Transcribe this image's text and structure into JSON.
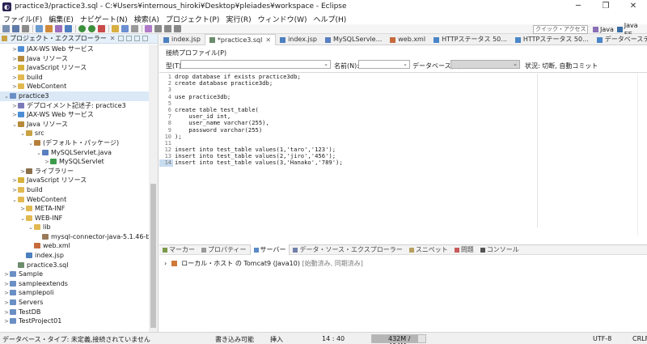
{
  "window": {
    "title": "practice3/practice3.sql - C:¥Users¥internous_hiroki¥Desktop¥pleiades¥workspace - Eclipse",
    "minimize": "─",
    "maximize": "❐",
    "close": "✕"
  },
  "menu": [
    "ファイル(F)",
    "編集(E)",
    "ナビゲート(N)",
    "検索(A)",
    "プロジェクト(P)",
    "実行(R)",
    "ウィンドウ(W)",
    "ヘルプ(H)"
  ],
  "toolbar": {
    "quick_access_placeholder": "クイック・アクセス",
    "perspective_java": "Java",
    "perspective_javaee": "Java EE"
  },
  "explorer": {
    "title": "プロジェクト・エクスプローラー",
    "tree": [
      {
        "label": "JAX-WS Web サービス",
        "arrow": ">",
        "icon": "web-service-icon"
      },
      {
        "label": "Java リソース",
        "arrow": ">",
        "icon": "java-resources-icon"
      },
      {
        "label": "JavaScript リソース",
        "arrow": ">",
        "icon": "javascript-resources-icon"
      },
      {
        "label": "build",
        "arrow": ">",
        "icon": "folder-icon"
      },
      {
        "label": "WebContent",
        "arrow": ">",
        "icon": "folder-icon"
      },
      {
        "label": "practice3",
        "arrow": "⌄",
        "icon": "project-icon",
        "selected": true
      },
      {
        "label": "デプロイメント記述子: practice3",
        "arrow": ">",
        "icon": "deployment-icon"
      },
      {
        "label": "JAX-WS Web サービス",
        "arrow": ">",
        "icon": "web-service-icon"
      },
      {
        "label": "Java リソース",
        "arrow": "⌄",
        "icon": "java-resources-icon"
      },
      {
        "label": "src",
        "arrow": "⌄",
        "icon": "source-folder-icon"
      },
      {
        "label": "(デフォルト・パッケージ)",
        "arrow": "⌄",
        "icon": "package-icon"
      },
      {
        "label": "MySQLServlet.java",
        "arrow": "⌄",
        "icon": "java-file-icon"
      },
      {
        "label": "MySQLServlet",
        "arrow": ">",
        "icon": "class-icon"
      },
      {
        "label": "ライブラリー",
        "arrow": ">",
        "icon": "library-icon"
      },
      {
        "label": "JavaScript リソース",
        "arrow": ">",
        "icon": "javascript-resources-icon"
      },
      {
        "label": "build",
        "arrow": ">",
        "icon": "folder-icon"
      },
      {
        "label": "WebContent",
        "arrow": "⌄",
        "icon": "folder-icon"
      },
      {
        "label": "META-INF",
        "arrow": ">",
        "icon": "folder-icon"
      },
      {
        "label": "WEB-INF",
        "arrow": "⌄",
        "icon": "folder-icon"
      },
      {
        "label": "lib",
        "arrow": "⌄",
        "icon": "folder-icon"
      },
      {
        "label": "mysql-connector-java-5.1.46-bin.jar",
        "arrow": "",
        "icon": "jar-icon"
      },
      {
        "label": "web.xml",
        "arrow": "",
        "icon": "xml-file-icon"
      },
      {
        "label": "index.jsp",
        "arrow": "",
        "icon": "jsp-file-icon"
      },
      {
        "label": "practice3.sql",
        "arrow": "",
        "icon": "sql-file-icon"
      },
      {
        "label": "Sample",
        "arrow": ">",
        "icon": "project-icon"
      },
      {
        "label": "sampleextends",
        "arrow": ">",
        "icon": "project-icon"
      },
      {
        "label": "samplepoli",
        "arrow": ">",
        "icon": "project-icon"
      },
      {
        "label": "Servers",
        "arrow": ">",
        "icon": "project-icon"
      },
      {
        "label": "TestDB",
        "arrow": ">",
        "icon": "project-icon"
      },
      {
        "label": "TestProject01",
        "arrow": ">",
        "icon": "project-icon"
      }
    ]
  },
  "editor_tabs": [
    {
      "label": "index.jsp",
      "icon": "jsp-file-icon"
    },
    {
      "label": "*practice3.sql",
      "icon": "sql-file-icon",
      "active": true
    },
    {
      "label": "index.jsp",
      "icon": "jsp-file-icon"
    },
    {
      "label": "MySQLServle...",
      "icon": "java-file-icon"
    },
    {
      "label": "web.xml",
      "icon": "xml-file-icon"
    },
    {
      "label": "HTTPステータス 50...",
      "icon": "browser-icon"
    },
    {
      "label": "HTTPステータス 50...",
      "icon": "browser-icon"
    },
    {
      "label": "データベーステスト",
      "icon": "browser-icon"
    }
  ],
  "connection": {
    "header": "接続プロファイル(P)",
    "type_label": "型(T):",
    "name_label": "名前(N):",
    "database_label": "データベース(B):",
    "status": "状況: 切断, 自動コミット"
  },
  "code": {
    "line_numbers": [
      "1",
      "2",
      "3",
      "4",
      "5",
      "6",
      "7",
      "8",
      "9",
      "10",
      "11",
      "12",
      "13",
      "14"
    ],
    "current_line": 14,
    "lines": [
      "drop database if exists practice3db;",
      "create database practice3db;",
      "",
      "use practice3db;",
      "",
      "create table test_table(",
      "    user_id int,",
      "    user_name varchar(255),",
      "    password varchar(255)",
      ");",
      "",
      "insert into test_table values(1,'taro','123');",
      "insert into test_table values(2,'jiro','456');",
      "insert into test_table values(3,'Hanako','789');"
    ]
  },
  "bottom_panel": {
    "tabs": [
      {
        "label": "マーカー",
        "icon": "marker-icon"
      },
      {
        "label": "プロパティー",
        "icon": "properties-icon"
      },
      {
        "label": "サーバー",
        "icon": "server-icon",
        "active": true
      },
      {
        "label": "データ・ソース・エクスプローラー",
        "icon": "datasource-icon"
      },
      {
        "label": "スニペット",
        "icon": "snippet-icon"
      },
      {
        "label": "問題",
        "icon": "problems-icon"
      },
      {
        "label": "コンソール",
        "icon": "console-icon"
      }
    ],
    "server_name": "ローカル・ホスト の Tomcat9 (Java10)",
    "server_state": "[始動済み, 同期済み]"
  },
  "status_bar": {
    "left": "データベース・タイプ: 未定義,接続されていません",
    "write_mode": "書き込み可能",
    "insert_mode": "挿入",
    "position": "14 : 40",
    "memory": "432M / 494M",
    "memory_used_fraction": 0.87,
    "encoding": "UTF-8",
    "line_ending": "CRLF"
  }
}
